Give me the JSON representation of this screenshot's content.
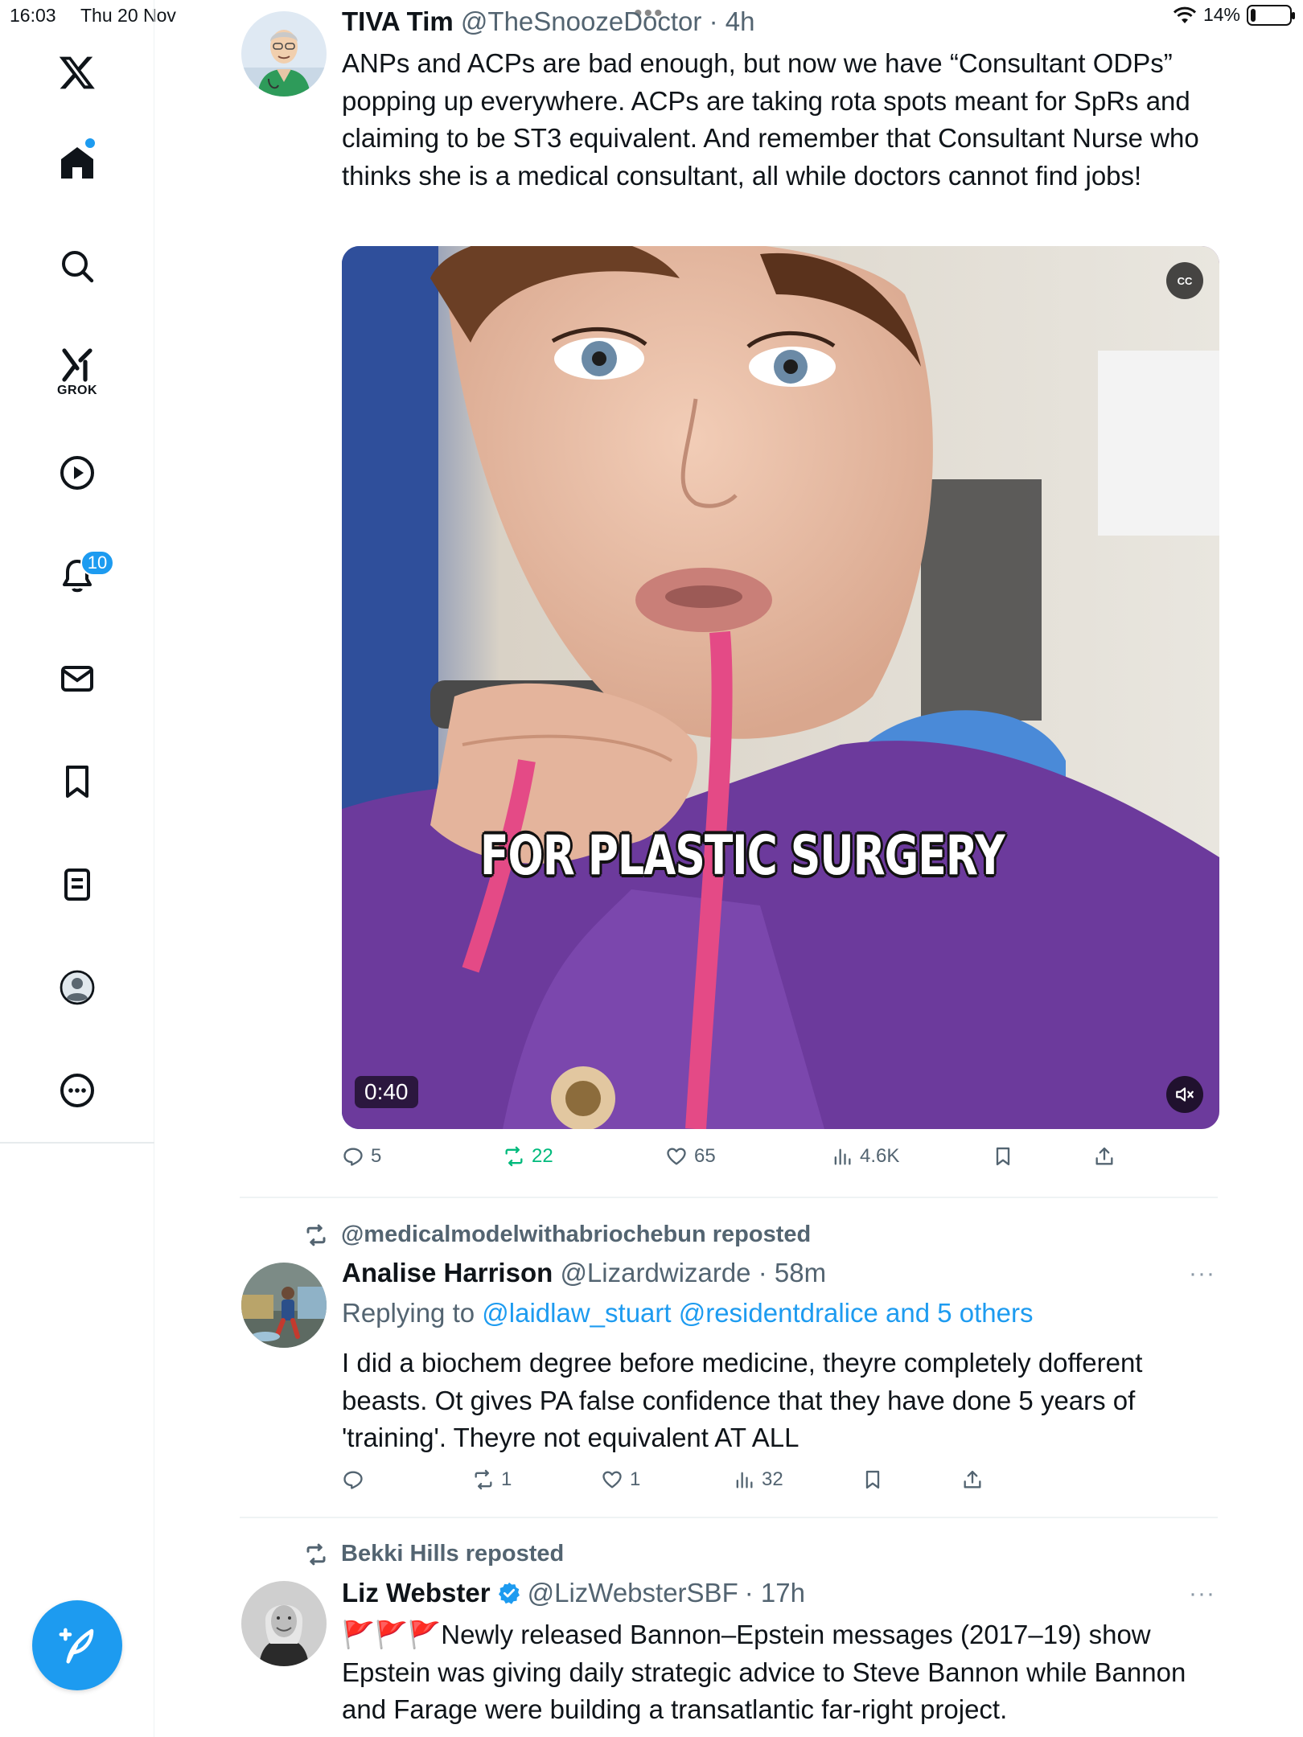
{
  "status_bar": {
    "time": "16:03",
    "date": "Thu 20 Nov",
    "battery": "14%",
    "battery_level": 0.14
  },
  "sidebar": {
    "items": [
      {
        "name": "x-logo",
        "icon": "x-logo-icon"
      },
      {
        "name": "home",
        "icon": "home-icon"
      },
      {
        "name": "explore",
        "icon": "search-icon"
      },
      {
        "name": "grok",
        "icon": "grok-icon",
        "label": "GROK"
      },
      {
        "name": "videos",
        "icon": "play-icon"
      },
      {
        "name": "notifications",
        "icon": "bell-icon",
        "badge": "10"
      },
      {
        "name": "messages",
        "icon": "mail-icon"
      },
      {
        "name": "bookmarks",
        "icon": "bookmark-icon"
      },
      {
        "name": "lists",
        "icon": "list-icon"
      },
      {
        "name": "profile",
        "icon": "profile-icon"
      },
      {
        "name": "more",
        "icon": "more-icon"
      }
    ],
    "compose_icon": "compose-icon"
  },
  "tweets": [
    {
      "name": "TIVA Tim",
      "handle": "@TheSnoozeDoctor",
      "time": "· 4h",
      "text": "ANPs and ACPs are bad enough, but now we have “Consultant ODPs” popping up everywhere. ACPs are taking rota spots meant for SpRs and claiming to be ST3 equivalent. And remember that Consultant Nurse who thinks she is a medical consultant, all while doctors cannot find jobs!",
      "video": {
        "caption": "FOR PLASTIC SURGERY",
        "duration": "0:40",
        "cc": "CC"
      },
      "actions": {
        "replies": "5",
        "reposts": "22",
        "likes": "65",
        "views": "4.6K"
      }
    },
    {
      "reposted_by": "@medicalmodelwithabriochebun reposted",
      "name": "Analise Harrison",
      "handle": "@Lizardwizarde",
      "time": "· 58m",
      "more": "···",
      "replying_label": "Replying to",
      "replying_links": "@laidlaw_stuart @residentdralice and 5 others",
      "text": "I did a biochem degree before medicine, theyre completely dofferent beasts. Ot gives PA false confidence that they have done 5 years of 'training'. Theyre not equivalent AT ALL",
      "actions": {
        "replies": "",
        "reposts": "1",
        "likes": "1",
        "views": "32"
      }
    },
    {
      "reposted_by": "Bekki Hills reposted",
      "name": "Liz Webster",
      "handle": "@LizWebsterSBF",
      "time": "· 17h",
      "more": "···",
      "verified": true,
      "text": "🚩🚩🚩Newly released Bannon–Epstein messages (2017–19) show Epstein was giving daily strategic advice to Steve Bannon while Bannon and Farage were building a transatlantic far-right project."
    }
  ],
  "colors": {
    "accent": "#1d9bf0",
    "repost_green": "#00ba7c",
    "muted": "#536471"
  }
}
